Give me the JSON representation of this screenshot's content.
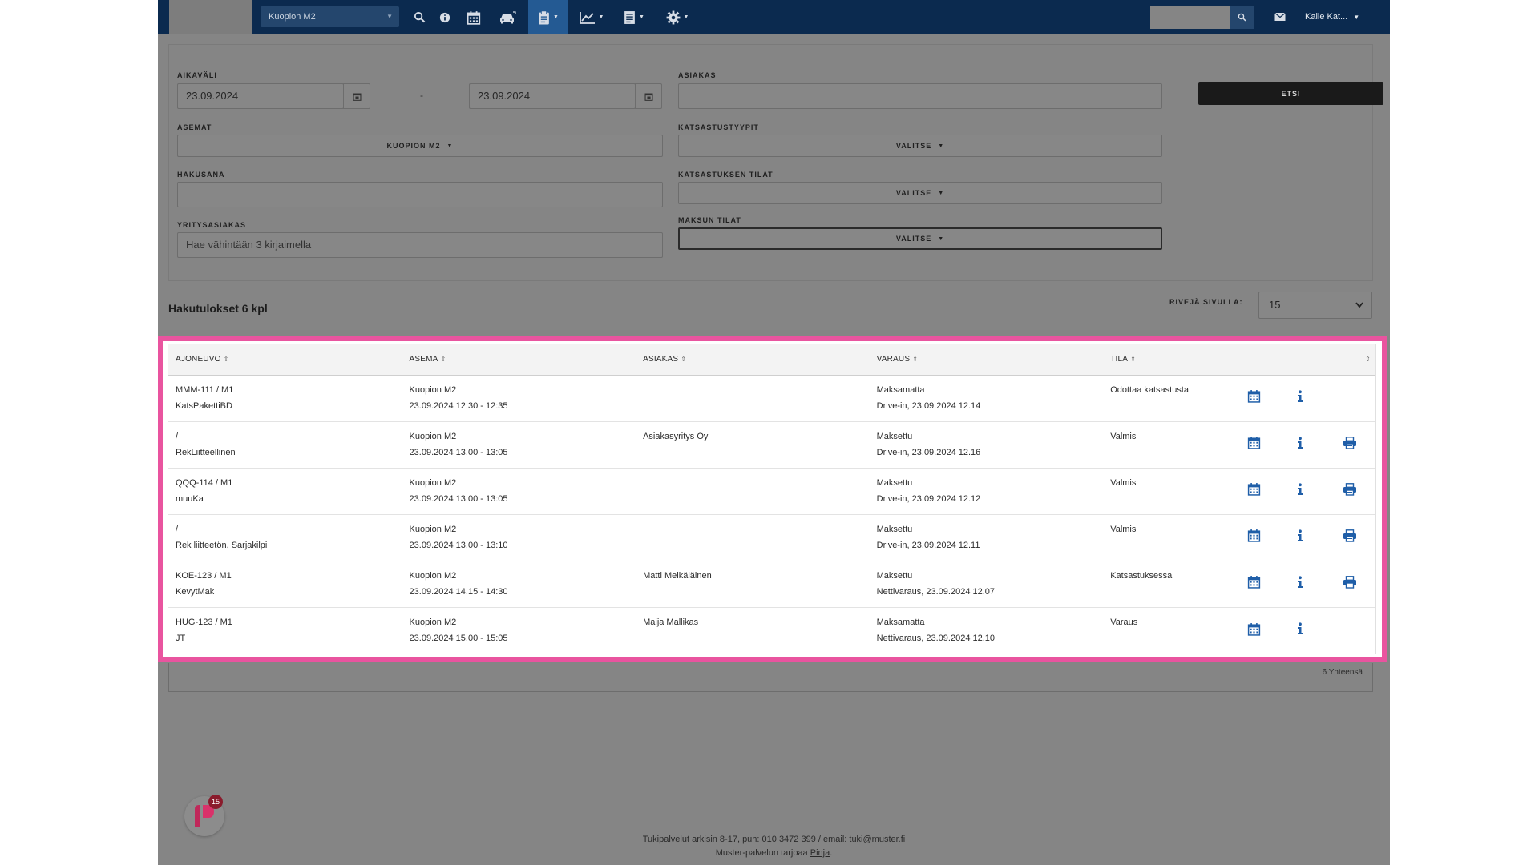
{
  "nav": {
    "station": "Kuopion M2",
    "user": "Kalle Kat...",
    "icons": [
      "search-icon",
      "info-icon",
      "calendar-icon",
      "car-icon",
      "clipboard-icon",
      "chart-icon",
      "report-icon",
      "gear-icon"
    ]
  },
  "filters": {
    "period_label": "AIKAVÄLI",
    "date_from": "23.09.2024",
    "date_sep": "-",
    "date_to": "23.09.2024",
    "customer_label": "ASIAKAS",
    "customer_value": "",
    "search_button": "ETSI",
    "stations_label": "ASEMAT",
    "stations_value": "KUOPION M2",
    "types_label": "KATSASTUSTYYPIT",
    "types_value": "VALITSE",
    "keyword_label": "HAKUSANA",
    "keyword_value": "",
    "states_label": "KATSASTUKSEN TILAT",
    "states_value": "VALITSE",
    "company_label": "YRITYSASIAKAS",
    "company_placeholder": "Hae vähintään 3 kirjaimella",
    "payment_label": "MAKSUN TILAT",
    "payment_value": "VALITSE"
  },
  "results": {
    "title": "Hakutulokset 6 kpl",
    "rows_label": "RIVEJÄ SIVULLA:",
    "rows_value": "15",
    "total": "6 Yhteensä"
  },
  "table": {
    "columns": [
      "AJONEUVO",
      "ASEMA",
      "ASIAKAS",
      "VARAUS",
      "TILA"
    ],
    "rows": [
      {
        "vehicle": "MMM-111 / M1",
        "vehicle2": "KatsPakettiBD",
        "station": "Kuopion M2",
        "time": "23.09.2024 12.30 - 12:35",
        "customer": "",
        "payment": "Maksamatta",
        "booking": "Drive-in, 23.09.2024 12.14",
        "status": "Odottaa katsastusta",
        "print": false
      },
      {
        "vehicle": "/",
        "vehicle2": "RekLiitteellinen",
        "station": "Kuopion M2",
        "time": "23.09.2024 13.00 - 13:05",
        "customer": "Asiakasyritys Oy",
        "payment": "Maksettu",
        "booking": "Drive-in, 23.09.2024 12.16",
        "status": "Valmis",
        "print": true
      },
      {
        "vehicle": "QQQ-114 / M1",
        "vehicle2": "muuKa",
        "station": "Kuopion M2",
        "time": "23.09.2024 13.00 - 13:05",
        "customer": "",
        "payment": "Maksettu",
        "booking": "Drive-in, 23.09.2024 12.12",
        "status": "Valmis",
        "print": true
      },
      {
        "vehicle": "/",
        "vehicle2": "Rek liitteetön, Sarjakilpi",
        "station": "Kuopion M2",
        "time": "23.09.2024 13.00 - 13:10",
        "customer": "",
        "payment": "Maksettu",
        "booking": "Drive-in, 23.09.2024 12.11",
        "status": "Valmis",
        "print": true
      },
      {
        "vehicle": "KOE-123 / M1",
        "vehicle2": "KevytMak",
        "station": "Kuopion M2",
        "time": "23.09.2024 14.15 - 14:30",
        "customer": "Matti Meikäläinen",
        "payment": "Maksettu",
        "booking": "Nettivaraus, 23.09.2024 12.07",
        "status": "Katsastuksessa",
        "print": true
      },
      {
        "vehicle": "HUG-123 / M1",
        "vehicle2": "JT",
        "station": "Kuopion M2",
        "time": "23.09.2024 15.00 - 15:05",
        "customer": "Maija Mallikas",
        "payment": "Maksamatta",
        "booking": "Nettivaraus, 23.09.2024 12.10",
        "status": "Varaus",
        "print": false
      }
    ]
  },
  "chat": {
    "badge": "15"
  },
  "footer": {
    "support": "Tukipalvelut arkisin 8-17, puh: 010 3472 399 / email: tuki@muster.fi",
    "provider_prefix": "Muster-palvelun tarjoaa ",
    "provider_link": "Pinja",
    "provider_suffix": "."
  },
  "colors": {
    "navbar": "#0b2a4f",
    "highlight": "#e9549f",
    "icon_blue": "#1f5ea8",
    "overlay": "#858585"
  }
}
